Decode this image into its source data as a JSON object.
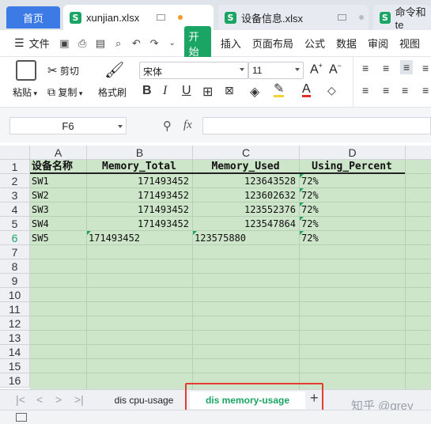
{
  "tabs": {
    "home": "首页",
    "docs": [
      {
        "name": "xunjian.xlsx",
        "active": true
      },
      {
        "name": "设备信息.xlsx",
        "active": false
      },
      {
        "name": "命令和te",
        "active": false
      }
    ]
  },
  "menu": {
    "file": "文件",
    "start": "开始",
    "items": [
      "插入",
      "页面布局",
      "公式",
      "数据",
      "审阅",
      "视图"
    ]
  },
  "ribbon": {
    "paste": "粘贴",
    "cut": "剪切",
    "copy": "复制",
    "format_painter": "格式刷",
    "font_name": "宋体",
    "font_size": "11"
  },
  "formula_bar": {
    "cell_ref": "F6",
    "fx": "fx",
    "value": ""
  },
  "sheet": {
    "columns": [
      "A",
      "B",
      "C",
      "D"
    ],
    "rows": [
      "1",
      "2",
      "3",
      "4",
      "5",
      "6",
      "7",
      "8",
      "9",
      "10",
      "11",
      "12",
      "13",
      "14",
      "15",
      "16"
    ],
    "header": [
      "设备名称",
      "Memory_Total",
      "Memory_Used",
      "Using_Percent"
    ],
    "data": [
      [
        "SW1",
        "171493452",
        "123643528",
        "72%"
      ],
      [
        "SW2",
        "171493452",
        "123602632",
        "72%"
      ],
      [
        "SW3",
        "171493452",
        "123552376",
        "72%"
      ],
      [
        "SW4",
        "171493452",
        "123547864",
        "72%"
      ],
      [
        "SW5",
        "171493452",
        "123575880",
        "72%"
      ]
    ]
  },
  "sheet_tabs": {
    "tabs": [
      "dis cpu-usage",
      "dis memory-usage"
    ],
    "active": "dis memory-usage",
    "add": "+"
  },
  "watermark": "知乎 @grey",
  "colors": {
    "accent": "#1aa564",
    "home_tab": "#3c7ae6",
    "cell_fill": "#cde5c9",
    "highlight_box": "#e63b30"
  }
}
